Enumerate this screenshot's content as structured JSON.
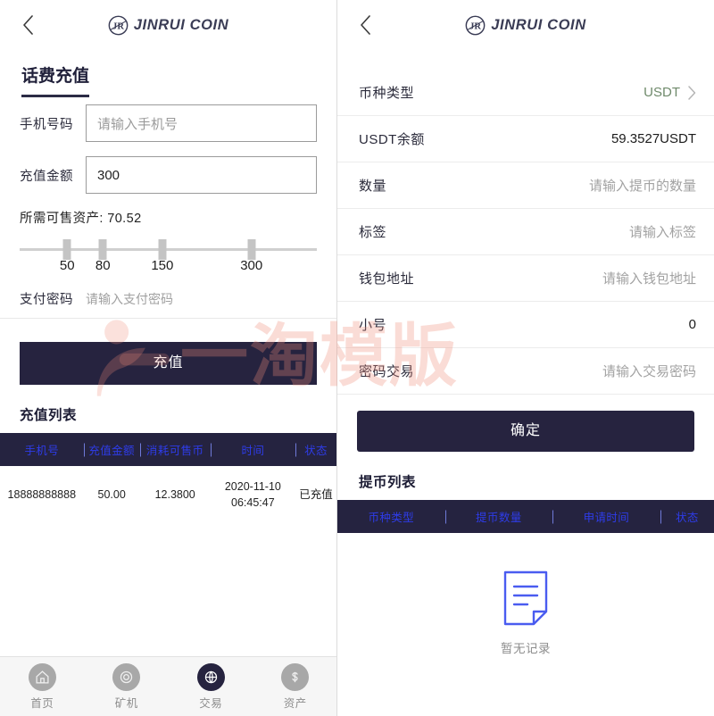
{
  "brand": {
    "name": "JINRUI COIN",
    "mark": "JR"
  },
  "watermark": {
    "text": "一淘模版"
  },
  "left": {
    "back_icon": "chevron-left-icon",
    "section_title": "话费充值",
    "phone": {
      "label": "手机号码",
      "value": "",
      "placeholder": "请输入手机号"
    },
    "amount": {
      "label": "充值金额",
      "value": "300",
      "placeholder": ""
    },
    "asset_line": "所需可售资产: 70.52",
    "slider": {
      "options": [
        "50",
        "80",
        "150",
        "300"
      ],
      "positions_pct": [
        16,
        28,
        48,
        78
      ],
      "selected": "300"
    },
    "pay_password": {
      "label": "支付密码",
      "value": "",
      "placeholder": "请输入支付密码"
    },
    "submit_label": "充值",
    "list_title": "充值列表",
    "table": {
      "headers": [
        "手机号",
        "充值金额",
        "消耗可售币",
        "时间",
        "状态"
      ],
      "rows": [
        [
          "18888888888",
          "50.00",
          "12.3800",
          "2020-11-10 06:45:47",
          "已充值"
        ]
      ]
    },
    "tabs": [
      {
        "label": "首页",
        "icon": "home-icon",
        "active": false
      },
      {
        "label": "矿机",
        "icon": "miner-icon",
        "active": false
      },
      {
        "label": "交易",
        "icon": "trade-globe-icon",
        "active": true
      },
      {
        "label": "资产",
        "icon": "dollar-icon",
        "active": false
      }
    ]
  },
  "right": {
    "back_icon": "chevron-left-icon",
    "rows": [
      {
        "label": "币种类型",
        "value": "USDT",
        "style": "accent",
        "chevron": true
      },
      {
        "label": "USDT余额",
        "value": "59.3527USDT",
        "style": "normal",
        "chevron": false
      },
      {
        "label": "数量",
        "value": "请输入提币的数量",
        "style": "muted",
        "chevron": false
      },
      {
        "label": "标签",
        "value": "请输入标签",
        "style": "muted",
        "chevron": false
      },
      {
        "label": "钱包地址",
        "value": "请输入钱包地址",
        "style": "muted",
        "chevron": false
      },
      {
        "label": "小号",
        "value": "0",
        "style": "normal",
        "chevron": false
      },
      {
        "label": "密码交易",
        "value": "请输入交易密码",
        "style": "muted",
        "chevron": false
      }
    ],
    "submit_label": "确定",
    "list_title": "提币列表",
    "table": {
      "headers": [
        "币种类型",
        "提币数量",
        "申请时间",
        "状态"
      ],
      "rows": []
    },
    "empty": {
      "icon": "document-empty-icon",
      "label": "暂无记录"
    }
  },
  "colors": {
    "primary_dark": "#26233f",
    "table_header_bg": "#252340",
    "table_header_text": "#2e3ce8",
    "accent_green": "#6f8a6b",
    "empty_icon_blue": "#4a5cf0",
    "watermark_pink": "#f08c78"
  }
}
